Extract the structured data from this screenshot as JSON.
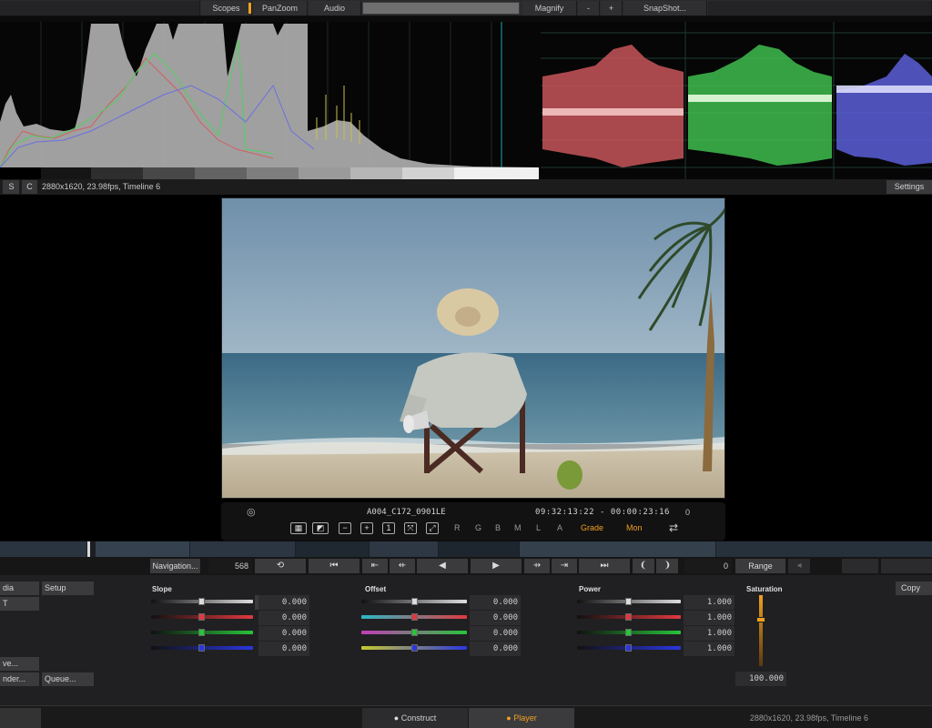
{
  "topbar": {
    "scopes": "Scopes",
    "panzoom": "PanZoom",
    "audio": "Audio",
    "magnify": "Magnify",
    "minus": "-",
    "plus": "+",
    "snapshot": "SnapShot..."
  },
  "infobar": {
    "btn_s": "S",
    "btn_c": "C",
    "info": "2880x1620, 23.98fps, Timeline 6",
    "settings": "Settings"
  },
  "viewer": {
    "clip_name": "A004_C172_0901LE",
    "timecode": "09:32:13:22 - 00:00:23:16",
    "frame_num": "0",
    "letters": [
      "R",
      "G",
      "B",
      "M",
      "L",
      "A"
    ],
    "grade_mode": "Grade",
    "mon_mode": "Mon"
  },
  "navrow": {
    "navigation": "Navigation...",
    "frame_field": "568",
    "right_field": "0",
    "range": "Range"
  },
  "grade": {
    "side_buttons": {
      "media": "dia",
      "setup": "Setup",
      "lut": "T",
      "save": "ve...",
      "render": "nder...",
      "queue": "Queue..."
    },
    "slope": {
      "title": "Slope",
      "values": [
        "0.000",
        "0.000",
        "0.000",
        "0.000"
      ]
    },
    "offset": {
      "title": "Offset",
      "values": [
        "0.000",
        "0.000",
        "0.000",
        "0.000"
      ]
    },
    "power": {
      "title": "Power",
      "values": [
        "1.000",
        "1.000",
        "1.000",
        "1.000"
      ]
    },
    "saturation": {
      "title": "Saturation",
      "value": "100.000"
    },
    "copy": "Copy"
  },
  "bottombar": {
    "construct": "Construct",
    "player": "Player",
    "status": "2880x1620, 23.98fps, Timeline 6"
  },
  "colors": {
    "accent": "#f0a020",
    "red_channel": "#e0393e",
    "green_channel": "#28c43b",
    "blue_channel": "#2b36e0",
    "cyan_channel": "#2ab8c8",
    "magenta_channel": "#c43bb8",
    "yellow_channel": "#c8c830"
  }
}
